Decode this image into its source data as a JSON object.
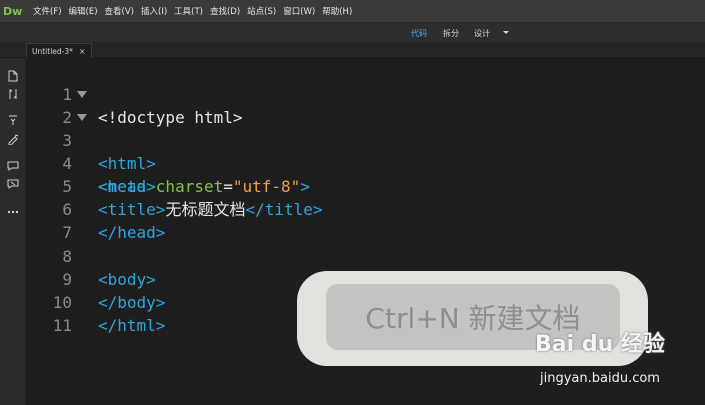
{
  "app": {
    "logo": "Dw"
  },
  "menu": [
    "文件(F)",
    "编辑(E)",
    "查看(V)",
    "插入(I)",
    "工具(T)",
    "查找(D)",
    "站点(S)",
    "窗口(W)",
    "帮助(H)"
  ],
  "view_modes": {
    "code": "代码",
    "split": "拆分",
    "design": "设计",
    "active": "代码"
  },
  "tab": {
    "label": "Untitled-3*",
    "close": "×"
  },
  "editor": {
    "lines": [
      {
        "n": "1",
        "fold": false
      },
      {
        "n": "2",
        "fold": true
      },
      {
        "n": "3",
        "fold": true
      },
      {
        "n": "4",
        "fold": false
      },
      {
        "n": "5",
        "fold": false
      },
      {
        "n": "6",
        "fold": false
      },
      {
        "n": "7",
        "fold": false
      },
      {
        "n": "8",
        "fold": false
      },
      {
        "n": "9",
        "fold": false
      },
      {
        "n": "10",
        "fold": false
      },
      {
        "n": "11",
        "fold": false
      }
    ],
    "code": {
      "l1": "<!doctype html>",
      "l2": "<html>",
      "l3": "<head>",
      "l4_tag_open": "<meta ",
      "l4_attr": "charset",
      "l4_eq": "=",
      "l4_val": "\"utf-8\"",
      "l4_close": ">",
      "l5_open": "<title>",
      "l5_text": "无标题文档",
      "l5_close": "</title>",
      "l6": "</head>",
      "l8": "<body>",
      "l9": "</body>",
      "l10": "</html>"
    }
  },
  "overlay": {
    "text": "Ctrl+N 新建文档"
  },
  "watermark": {
    "logo": "Bai du 经验",
    "url": "jingyan.baidu.com"
  },
  "colors": {
    "tag": "#2aa7de",
    "attr": "#82c341",
    "string": "#f0a040",
    "active_view": "#55a8f0",
    "logo": "#7ec24a"
  }
}
